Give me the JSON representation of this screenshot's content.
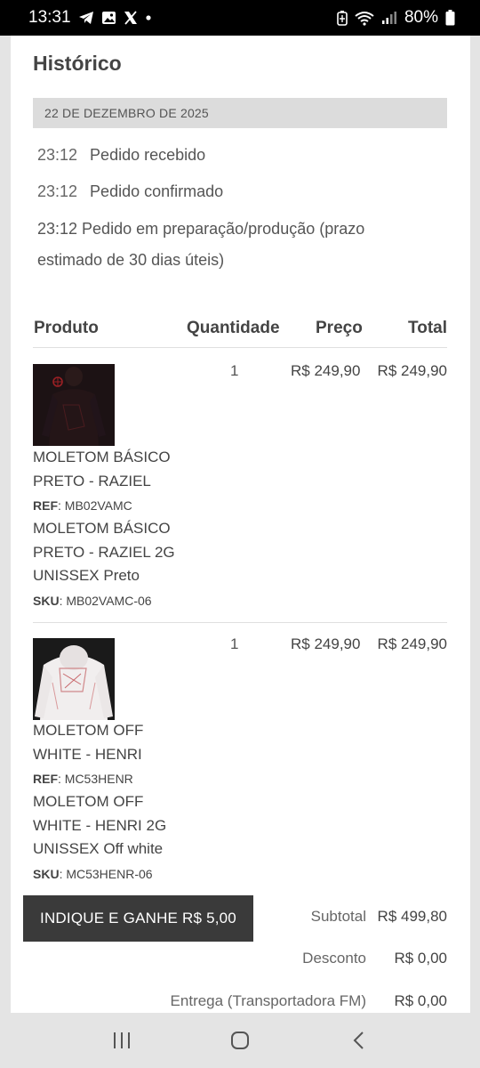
{
  "status_bar": {
    "time": "13:31",
    "battery": "80%",
    "left_icons": [
      "telegram-icon",
      "gallery-icon",
      "x-icon",
      "dot-icon"
    ],
    "right_icons": [
      "battery-saver-icon",
      "wifi-icon",
      "signal-icon",
      "battery-icon"
    ]
  },
  "history": {
    "title": "Histórico",
    "date": "22 DE DEZEMBRO DE 2025",
    "entries": [
      {
        "time": "23:12",
        "text": "Pedido recebido"
      },
      {
        "time": "23:12",
        "text": "Pedido confirmado"
      }
    ],
    "long_entry": "23:12 Pedido em preparação/produção (prazo estimado de 30 dias úteis)"
  },
  "table": {
    "headers": {
      "product": "Produto",
      "quantity": "Quantidade",
      "price": "Preço",
      "total": "Total"
    },
    "items": [
      {
        "quantity": "1",
        "price": "R$ 249,90",
        "total": "R$ 249,90",
        "name": "MOLETOM BÁSICO PRETO - RAZIEL",
        "ref_label": "REF",
        "ref": ": MB02VAMC",
        "variant": "MOLETOM BÁSICO PRETO - RAZIEL 2G UNISSEX Preto",
        "sku_label": "SKU",
        "sku": ": MB02VAMC-06",
        "image_color": "#1c1214"
      },
      {
        "quantity": "1",
        "price": "R$ 249,90",
        "total": "R$ 249,90",
        "name": "MOLETOM OFF WHITE - HENRI",
        "ref_label": "REF",
        "ref": ": MC53HENR",
        "variant": "MOLETOM OFF WHITE - HENRI 2G UNISSEX Off white",
        "sku_label": "SKU",
        "sku": ": MC53HENR-06",
        "image_color": "#f1eeee"
      }
    ]
  },
  "summary": {
    "refer_button": "INDIQUE E GANHE R$ 5,00",
    "subtotal_label": "Subtotal",
    "subtotal": "R$ 499,80",
    "discount_label": "Desconto",
    "discount": "R$ 0,00",
    "shipping_label": "Entrega (Transportadora FM)",
    "shipping": "R$ 0,00"
  },
  "nav": {
    "buttons": [
      "recent-apps-icon",
      "home-icon",
      "back-icon"
    ]
  }
}
